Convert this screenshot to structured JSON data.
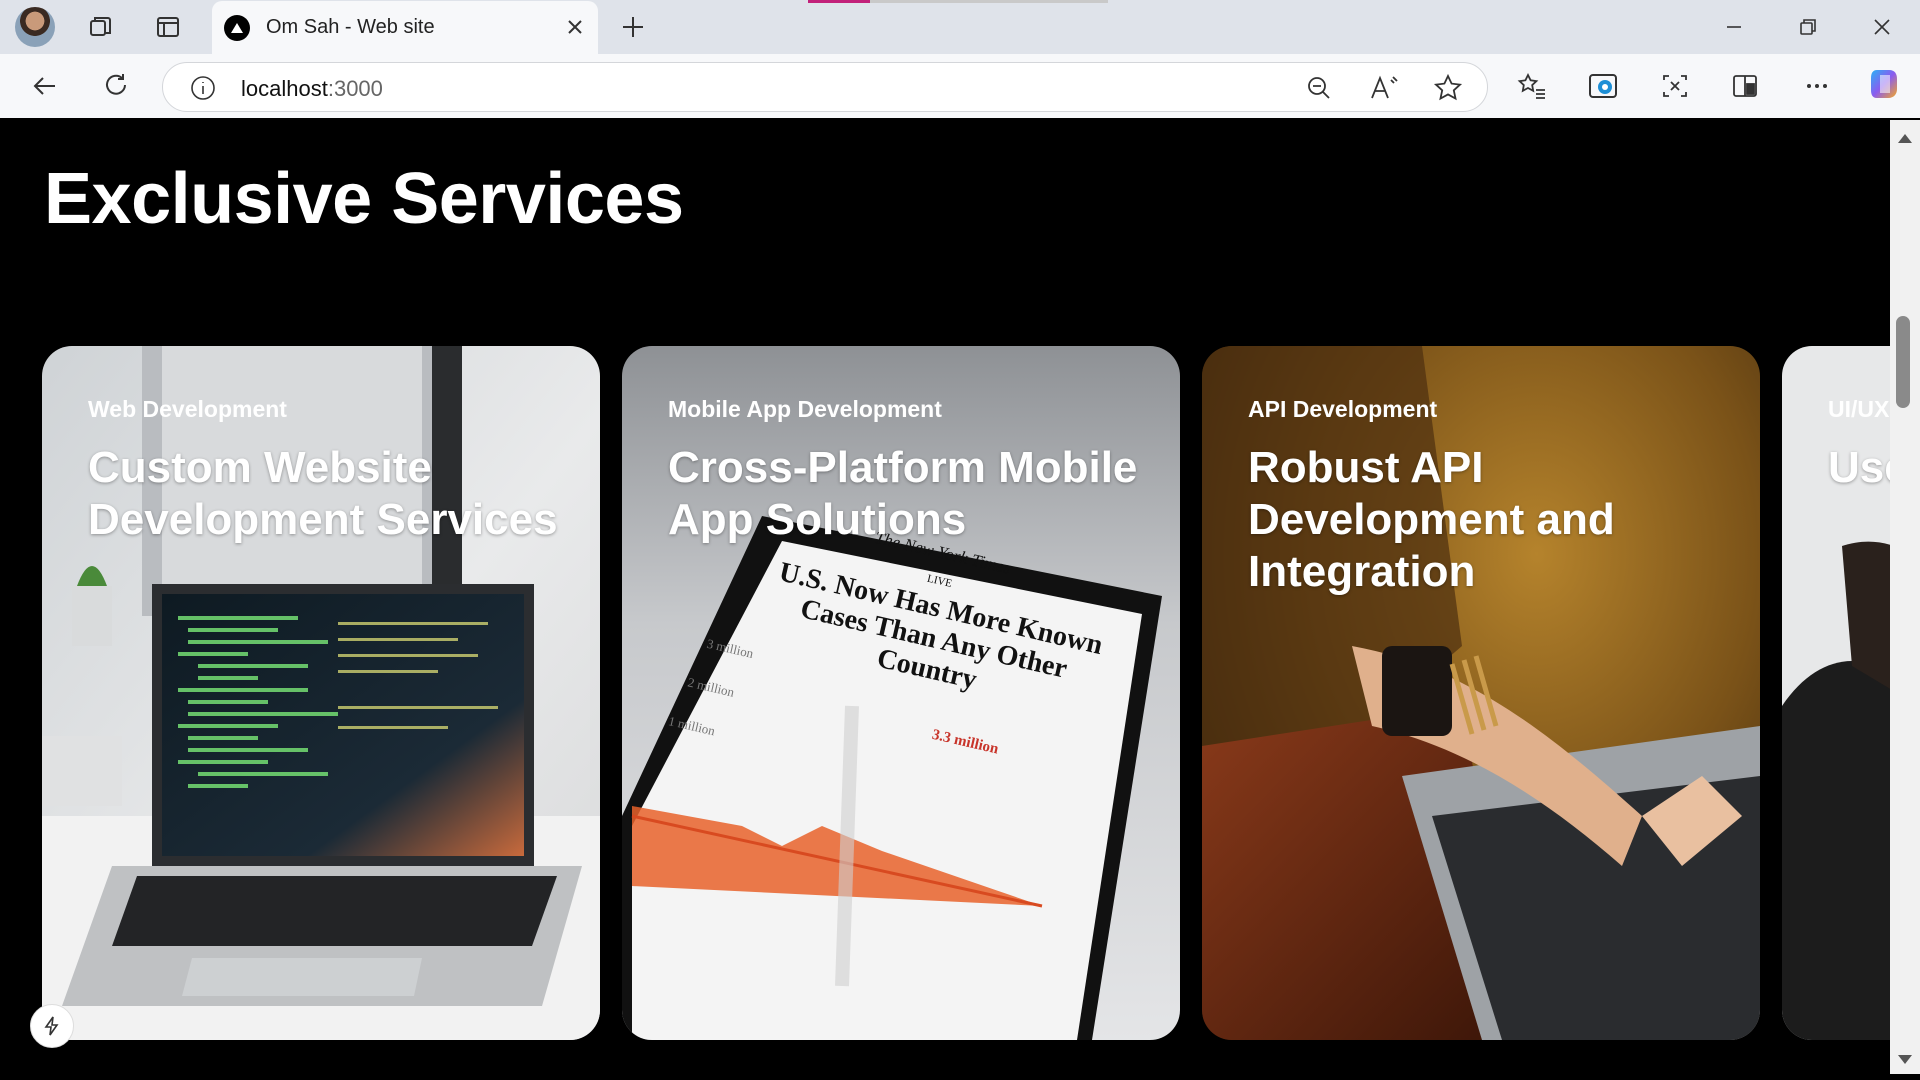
{
  "browser": {
    "tab_title": "Om Sah - Web site",
    "address": {
      "host": "localhost",
      "port": ":3000"
    }
  },
  "page": {
    "heading": "Exclusive Services",
    "cards": [
      {
        "category": "Web Development",
        "headline": "Custom Website Development Services"
      },
      {
        "category": "Mobile App Development",
        "headline": "Cross-Platform Mobile App Solutions"
      },
      {
        "category": "API Development",
        "headline": "Robust API Development and Integration"
      },
      {
        "category": "UI/UX",
        "headline": "Use De"
      }
    ],
    "phone_screen": {
      "masthead": "The New York Times",
      "live": "LIVE",
      "headline": "U.S. Now Has More Known Cases Than Any Other Country",
      "axis": [
        "3 million",
        "2 million",
        "1 million"
      ],
      "callout": "3.3 million"
    }
  },
  "colors": {
    "page_bg": "#000000",
    "accent_loading": "#c2217a"
  }
}
